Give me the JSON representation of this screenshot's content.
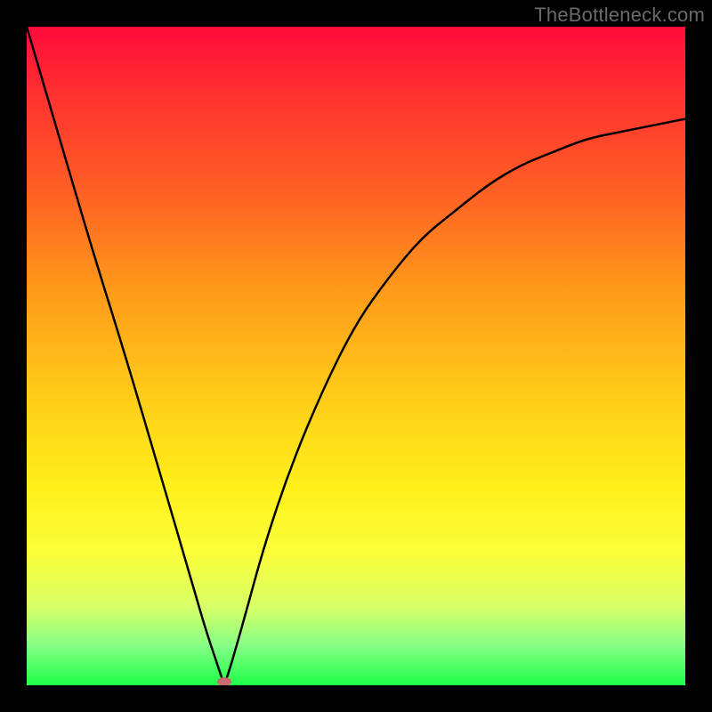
{
  "watermark": {
    "text": "TheBottleneck.com"
  },
  "chart_data": {
    "type": "line",
    "title": "",
    "xlabel": "",
    "ylabel": "",
    "xlim": [
      0,
      100
    ],
    "ylim": [
      0,
      100
    ],
    "grid": false,
    "legend": false,
    "series": [
      {
        "name": "bottleneck-curve",
        "x": [
          0,
          5,
          10,
          15,
          20,
          25,
          27,
          29,
          30,
          31,
          33,
          36,
          40,
          45,
          50,
          55,
          60,
          65,
          70,
          75,
          80,
          85,
          90,
          95,
          100
        ],
        "y": [
          100,
          83,
          66,
          50,
          33,
          16,
          9,
          3,
          0,
          3,
          10,
          21,
          33,
          45,
          55,
          62,
          68,
          72,
          76,
          79,
          81,
          83,
          84,
          85,
          86
        ]
      }
    ],
    "marker": {
      "x": 30,
      "y": 0
    },
    "background_gradient_stops": [
      {
        "pos": 0.0,
        "color": "#ff0b3b"
      },
      {
        "pos": 0.1,
        "color": "#ff3030"
      },
      {
        "pos": 0.25,
        "color": "#ff5f24"
      },
      {
        "pos": 0.4,
        "color": "#ff9a1a"
      },
      {
        "pos": 0.55,
        "color": "#ffc919"
      },
      {
        "pos": 0.7,
        "color": "#fff01b"
      },
      {
        "pos": 0.8,
        "color": "#fbff3b"
      },
      {
        "pos": 0.88,
        "color": "#d8ff67"
      },
      {
        "pos": 0.94,
        "color": "#86ff86"
      },
      {
        "pos": 1.0,
        "color": "#1eff48"
      }
    ]
  }
}
